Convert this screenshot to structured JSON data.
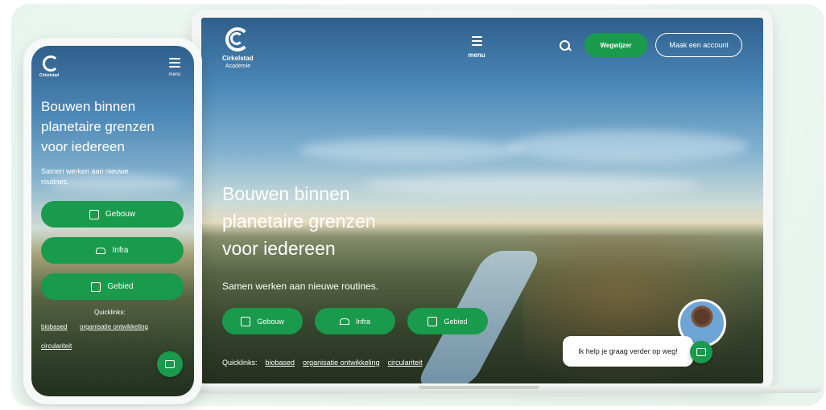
{
  "brand": {
    "name": "Cirkelstad",
    "subtitle": "Academie"
  },
  "nav": {
    "menu_label": "menu",
    "wegwijzer_label": "Wegwijzer",
    "account_label": "Maak een account"
  },
  "hero": {
    "title_line1": "Bouwen binnen",
    "title_line2": "planetaire grenzen",
    "title_line3": "voor iedereen",
    "subtitle": "Samen werken aan nieuwe routines.",
    "mobile_subtitle_line1": "Samen werken aan nieuwe",
    "mobile_subtitle_line2": "routines."
  },
  "categories": [
    {
      "label": "Gebouw",
      "icon": "building-icon"
    },
    {
      "label": "Infra",
      "icon": "bridge-icon"
    },
    {
      "label": "Gebied",
      "icon": "map-icon"
    }
  ],
  "quicklinks": {
    "label": "Quicklinks:",
    "links": [
      "biobased",
      "organisatie ontwikkeling",
      "circulariteit"
    ]
  },
  "chat": {
    "message": "Ik help je graag verder op weg!",
    "icon": "chat-icon"
  },
  "colors": {
    "accent": "#1a9a4c",
    "backdrop": "#e8f5ee"
  }
}
